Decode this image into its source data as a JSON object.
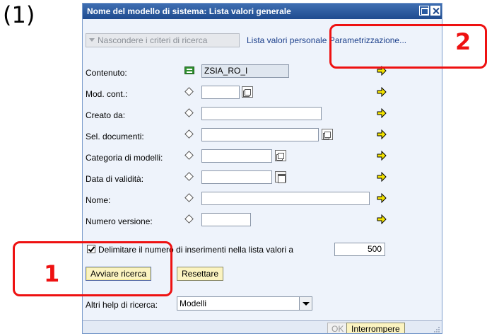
{
  "step_label": "(1)",
  "dialog": {
    "title": "Nome del modello di sistema: Lista valori generale",
    "toolbar": {
      "hide_criteria": "Nascondere i criteri di ricerca",
      "links": "Lista valori personale Parametrizzazione..."
    },
    "fields": [
      {
        "label": "Contenuto:",
        "value": "ZSIA_RO_I"
      },
      {
        "label": "Mod. cont.:",
        "value": ""
      },
      {
        "label": "Creato da:",
        "value": ""
      },
      {
        "label": "Sel. documenti:",
        "value": ""
      },
      {
        "label": "Categoria di modelli:",
        "value": ""
      },
      {
        "label": "Data di validità:",
        "value": ""
      },
      {
        "label": "Nome:",
        "value": ""
      },
      {
        "label": "Numero versione:",
        "value": ""
      }
    ],
    "limit": {
      "label": "Delimitare il numero di inserimenti nella lista valori a",
      "value": "500"
    },
    "buttons": {
      "start_search": "Avviare ricerca",
      "reset": "Resettare",
      "ok": "OK",
      "cancel": "Interrompere"
    },
    "other_help": {
      "label": "Altri help di ricerca:",
      "selected": "Modelli"
    }
  },
  "callouts": [
    {
      "number": "1"
    },
    {
      "number": "2"
    }
  ],
  "colors": {
    "callout": "#ee1111",
    "title_bar": "#2a5aa0",
    "button_bg": "#fbf3c0"
  }
}
